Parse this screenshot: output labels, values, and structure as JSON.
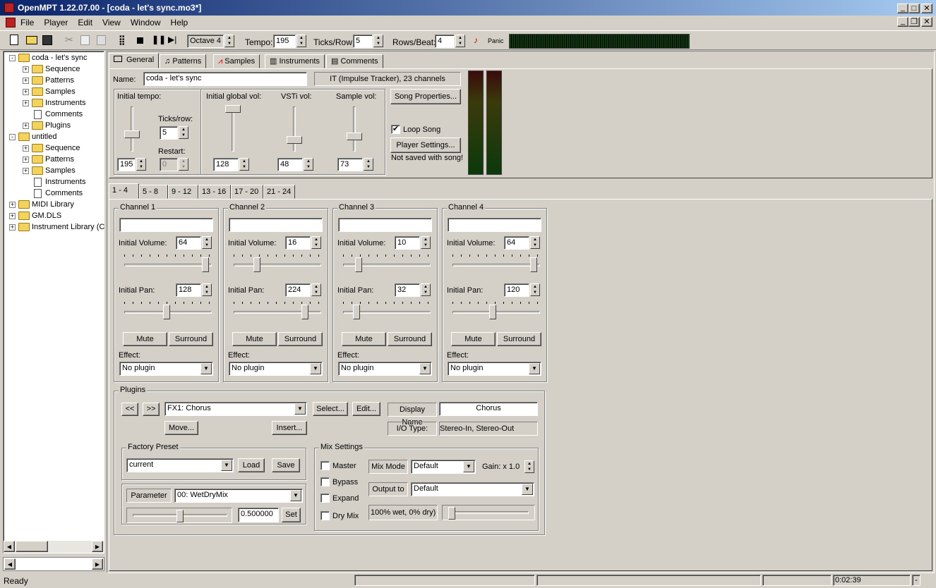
{
  "window": {
    "title": "OpenMPT 1.22.07.00 - [coda - let's sync.mo3*]"
  },
  "menu": [
    "File",
    "Player",
    "Edit",
    "View",
    "Window",
    "Help"
  ],
  "toolbar": {
    "octave": "Octave 4",
    "tempo_label": "Tempo:",
    "tempo": "195",
    "ticks_label": "Ticks/Row:",
    "ticks": "5",
    "rows_label": "Rows/Beat:",
    "rows": "4",
    "panic": "Panic"
  },
  "tree": [
    {
      "label": "coda - let's sync",
      "type": "folder",
      "level": 0,
      "expand": "-"
    },
    {
      "label": "Sequence",
      "type": "folder",
      "level": 1,
      "expand": "+"
    },
    {
      "label": "Patterns",
      "type": "folder",
      "level": 1,
      "expand": "+"
    },
    {
      "label": "Samples",
      "type": "folder",
      "level": 1,
      "expand": "+"
    },
    {
      "label": "Instruments",
      "type": "folder",
      "level": 1,
      "expand": "+"
    },
    {
      "label": "Comments",
      "type": "doc",
      "level": 1,
      "expand": ""
    },
    {
      "label": "Plugins",
      "type": "folder",
      "level": 1,
      "expand": "+"
    },
    {
      "label": "untitled",
      "type": "folder",
      "level": 0,
      "expand": "-"
    },
    {
      "label": "Sequence",
      "type": "folder",
      "level": 1,
      "expand": "+"
    },
    {
      "label": "Patterns",
      "type": "folder",
      "level": 1,
      "expand": "+"
    },
    {
      "label": "Samples",
      "type": "folder",
      "level": 1,
      "expand": "+"
    },
    {
      "label": "Instruments",
      "type": "doc",
      "level": 1,
      "expand": ""
    },
    {
      "label": "Comments",
      "type": "doc",
      "level": 1,
      "expand": ""
    },
    {
      "label": "MIDI Library",
      "type": "folder",
      "level": 0,
      "expand": "+"
    },
    {
      "label": "GM.DLS",
      "type": "folder",
      "level": 0,
      "expand": "+"
    },
    {
      "label": "Instrument Library (C",
      "type": "folder",
      "level": 0,
      "expand": "+"
    }
  ],
  "tabs": [
    "General",
    "Patterns",
    "Samples",
    "Instruments",
    "Comments"
  ],
  "general": {
    "name_label": "Name:",
    "name": "coda - let's sync",
    "format": "IT (Impulse Tracker), 23 channels",
    "init_tempo_label": "Initial tempo:",
    "init_tempo": "195",
    "ticks_label": "Ticks/row:",
    "ticks": "5",
    "restart_label": "Restart:",
    "restart": "0",
    "global_vol_label": "Initial global vol:",
    "global_vol": "128",
    "vsti_label": "VSTi vol:",
    "vsti": "48",
    "sample_vol_label": "Sample vol:",
    "sample_vol": "73",
    "song_props": "Song Properties...",
    "loop_song": "Loop Song",
    "player_settings": "Player Settings...",
    "not_saved": "Not saved with song!"
  },
  "channel_tabs": [
    "1 - 4",
    "5 - 8",
    "9 - 12",
    "13 - 16",
    "17 - 20",
    "21 - 24"
  ],
  "channel_labels": {
    "vol": "Initial Volume:",
    "pan": "Initial Pan:",
    "mute": "Mute",
    "surround": "Surround",
    "effect": "Effect:",
    "no_plugin": "No plugin"
  },
  "channels": [
    {
      "title": "Channel 1",
      "name": "",
      "volume": "64",
      "pan": "128",
      "vol_frac": 1.0,
      "pan_frac": 0.5
    },
    {
      "title": "Channel 2",
      "name": "",
      "volume": "16",
      "pan": "224",
      "vol_frac": 0.25,
      "pan_frac": 0.875
    },
    {
      "title": "Channel 3",
      "name": "",
      "volume": "10",
      "pan": "32",
      "vol_frac": 0.156,
      "pan_frac": 0.125
    },
    {
      "title": "Channel 4",
      "name": "",
      "volume": "64",
      "pan": "120",
      "vol_frac": 1.0,
      "pan_frac": 0.469
    }
  ],
  "plugins": {
    "title": "Plugins",
    "prev": "<<",
    "next": ">>",
    "fx": "FX1: Chorus",
    "select": "Select...",
    "edit": "Edit...",
    "display_name_label": "Display Name",
    "display_name": "Chorus",
    "move": "Move...",
    "insert": "Insert...",
    "io_label": "I/O Type:",
    "io": "Stereo-In, Stereo-Out",
    "factory_title": "Factory Preset",
    "preset": "current",
    "load": "Load",
    "save": "Save",
    "param_label": "Parameter",
    "param": "00: WetDryMix",
    "param_value": "0.500000",
    "set": "Set",
    "mix_title": "Mix Settings",
    "master": "Master",
    "bypass": "Bypass",
    "expand": "Expand",
    "drymix": "Dry Mix",
    "mix_mode_label": "Mix Mode",
    "mix_mode": "Default",
    "gain": "Gain: x 1.0",
    "output_label": "Output to",
    "output": "Default",
    "wet": "100% wet, 0% dry)"
  },
  "status": {
    "ready": "Ready",
    "time": "0:02:39",
    "dash": "-"
  }
}
